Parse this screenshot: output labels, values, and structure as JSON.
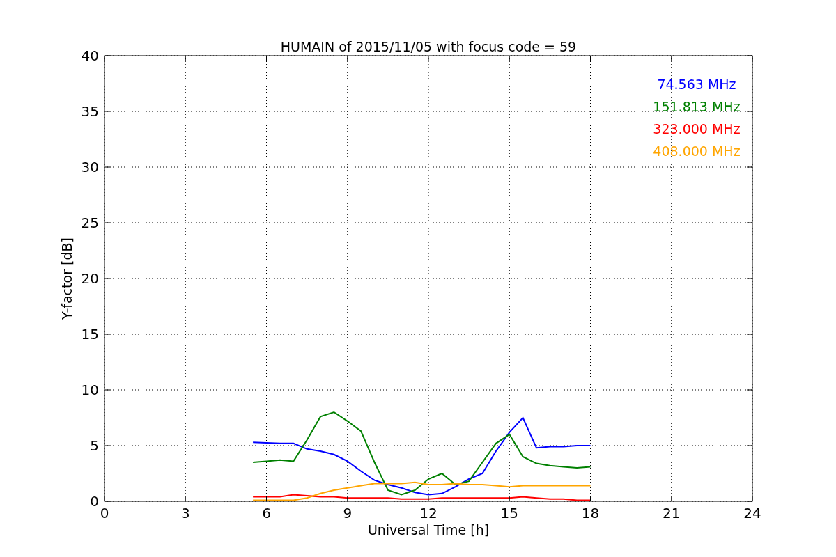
{
  "figure": {
    "chart_data": {
      "type": "line",
      "title": "HUMAIN of 2015/11/05 with focus code = 59",
      "xlabel": "Universal Time [h]",
      "ylabel": "Y-factor [dB]",
      "x": [
        5.5,
        6,
        6.5,
        7,
        7.5,
        8,
        8.5,
        9,
        9.5,
        10,
        10.5,
        11,
        11.5,
        12,
        12.5,
        13,
        13.5,
        14,
        14.5,
        15,
        15.5,
        16,
        16.5,
        17,
        17.5,
        18
      ],
      "series": [
        {
          "name": "74.563 MHz",
          "color": "#0000ff",
          "values": [
            5.3,
            5.25,
            5.2,
            5.2,
            4.7,
            4.5,
            4.2,
            3.6,
            2.7,
            1.9,
            1.5,
            1.2,
            0.8,
            0.6,
            0.7,
            1.3,
            2.0,
            2.5,
            4.5,
            6.2,
            7.5,
            4.8,
            4.9,
            4.9,
            5.0,
            5.0
          ]
        },
        {
          "name": "151.813 MHz",
          "color": "#008000",
          "values": [
            3.5,
            3.6,
            3.7,
            3.6,
            5.5,
            7.6,
            8.0,
            7.2,
            6.3,
            3.5,
            1.0,
            0.6,
            1.0,
            2.0,
            2.5,
            1.5,
            1.8,
            3.5,
            5.2,
            6.0,
            4.0,
            3.4,
            3.2,
            3.1,
            3.0,
            3.1
          ]
        },
        {
          "name": "323.000 MHz",
          "color": "#ff0000",
          "values": [
            0.4,
            0.4,
            0.4,
            0.6,
            0.5,
            0.4,
            0.4,
            0.3,
            0.3,
            0.3,
            0.3,
            0.2,
            0.2,
            0.2,
            0.3,
            0.3,
            0.3,
            0.3,
            0.3,
            0.3,
            0.4,
            0.3,
            0.2,
            0.2,
            0.1,
            0.1
          ]
        },
        {
          "name": "408.000 MHz",
          "color": "#ffa500",
          "values": [
            0.1,
            0.1,
            0.1,
            0.1,
            0.3,
            0.7,
            1.0,
            1.2,
            1.4,
            1.6,
            1.6,
            1.6,
            1.7,
            1.5,
            1.5,
            1.6,
            1.5,
            1.5,
            1.4,
            1.3,
            1.4,
            1.4,
            1.4,
            1.4,
            1.4,
            1.4
          ]
        }
      ],
      "grid": true,
      "xlim": [
        0,
        24
      ],
      "ylim": [
        0,
        40
      ],
      "xticks": [
        0,
        3,
        6,
        9,
        12,
        15,
        18,
        21,
        24
      ],
      "yticks": [
        0,
        5,
        10,
        15,
        20,
        25,
        30,
        35,
        40
      ]
    }
  }
}
